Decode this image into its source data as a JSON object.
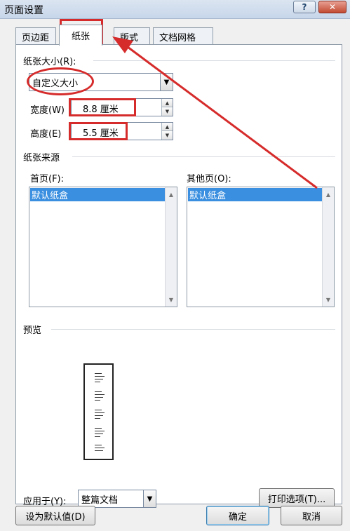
{
  "window": {
    "title": "页面设置",
    "help_label": "?",
    "close_label": "✕"
  },
  "tabs": [
    {
      "label": "页边距",
      "active": false
    },
    {
      "label": "纸张",
      "active": true
    },
    {
      "label": "版式",
      "active": false
    },
    {
      "label": "文档网格",
      "active": false
    }
  ],
  "paper_size": {
    "section_label": "纸张大小(R):",
    "selected": "自定义大小",
    "width_label": "宽度(W)",
    "width_value": "8.8 厘米",
    "height_label": "高度(E)",
    "height_value": "5.5 厘米"
  },
  "paper_source": {
    "section_label": "纸张来源",
    "first_page_label": "首页(F):",
    "first_page_items": [
      "默认纸盒"
    ],
    "other_pages_label": "其他页(O):",
    "other_pages_items": [
      "默认纸盒"
    ]
  },
  "preview": {
    "section_label": "预览"
  },
  "apply_to": {
    "label": "应用于(Y):",
    "value": "整篇文档"
  },
  "buttons": {
    "print_options": "打印选项(T)...",
    "set_default": "设为默认值(D)",
    "ok": "确定",
    "cancel": "取消"
  },
  "annotation_color": "#d62b2b"
}
